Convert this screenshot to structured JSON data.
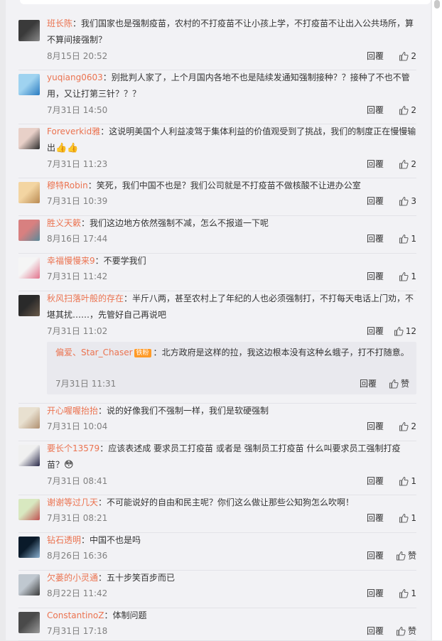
{
  "comments": [
    {
      "user": "班长陈",
      "text": "我们国家也是强制疫苗，农村的不打疫苗不让小孩上学，不打疫苗不让出入公共场所，算不算间接强制？",
      "time": "8月15日 20:52",
      "reply": "回覆",
      "likes": "2",
      "avatar_colors": [
        "#3a3a3a",
        "#8a8a8a"
      ]
    },
    {
      "user": "yuqiang0603",
      "text": "别批判人家了，上个月国内各地不也是陆续发通知强制接种？？接种了不也不管用，又让打第三针？？？",
      "time": "7月31日 14:50",
      "reply": "回覆",
      "likes": "2",
      "avatar_colors": [
        "#9fd3f0",
        "#2a7bc0"
      ]
    },
    {
      "user": "Foreverkid雅",
      "text": "这说明美国个人利益凌驾于集体利益的价值观受到了挑战，我们的制度正在慢慢输出",
      "time": "7月31日 11:23",
      "reply": "回覆",
      "likes": "2",
      "avatar_colors": [
        "#e8d0c8",
        "#2b2b2b"
      ]
    },
    {
      "user": "穆特Robin",
      "text": "笑死，我们中国不也是？我们公司就是不打疫苗不做核酸不让进办公室",
      "time": "7月31日 10:39",
      "reply": "回覆",
      "likes": "3",
      "avatar_colors": [
        "#f3d5a2",
        "#b98a52"
      ]
    },
    {
      "user": "胜义天簌",
      "text": "我们这边地方依然强制不减，怎么不报道一下呢",
      "time": "8月16日 17:44",
      "reply": "回覆",
      "likes": "1",
      "avatar_colors": [
        "#d88080",
        "#5a8a9a"
      ]
    },
    {
      "user": "幸福慢慢来9",
      "text": "不要学我们",
      "time": "7月31日 11:42",
      "reply": "回覆",
      "likes": "1",
      "avatar_colors": [
        "#f5f5f5",
        "#e2738c"
      ]
    },
    {
      "user": "秋风扫落叶般的存在",
      "text": "半斤八两，甚至农村上了年纪的人也必须强制打，不打每天电话上门劝，不堪其扰……，先管好自己再说吧",
      "time": "7月31日 11:02",
      "reply": "回覆",
      "likes": "12",
      "avatar_colors": [
        "#2a2a2a",
        "#6a5a4a"
      ]
    },
    {
      "user": "开心喔喔抬抬",
      "text": "说的好像我们不强制一样，我们是软硬强制",
      "time": "7月31日 10:04",
      "reply": "回覆",
      "likes": "2",
      "avatar_colors": [
        "#e8e0d0",
        "#b09070"
      ]
    },
    {
      "user": "要长个13579",
      "text": "应该表述成 要求员工打疫苗 或者是 强制员工打疫苗 什么叫要求员工强制打疫苗？",
      "time": "7月31日 08:41",
      "reply": "回覆",
      "likes": "1",
      "avatar_colors": [
        "#f0f0f0",
        "#2a2a4a"
      ]
    },
    {
      "user": "谢谢等过几天",
      "text": "不可能说好的自由和民主呢？你们这么做让那些公知狗怎么吹啊！",
      "time": "7月31日 08:21",
      "reply": "回覆",
      "likes": "1",
      "avatar_colors": [
        "#d8e8c0",
        "#c05050"
      ]
    },
    {
      "user": "钻石透明",
      "text": "中国不也是吗",
      "time": "8月26日 16:36",
      "reply": "回覆",
      "likes": "赞",
      "avatar_colors": [
        "#0a1a2a",
        "#8ab0d0"
      ]
    },
    {
      "user": "欠蒌的小灵通",
      "text": "五十步笑百步而已",
      "time": "8月22日 11:42",
      "reply": "回覆",
      "likes": "1",
      "avatar_colors": [
        "#c0c8d0",
        "#3a3a3a"
      ]
    },
    {
      "user": "ConstantinoZ",
      "text": "体制问题",
      "time": "7月31日 17:18",
      "reply": "回覆",
      "likes": "赞",
      "avatar_colors": [
        "#4a4a4a",
        "#9a9a9a"
      ]
    }
  ],
  "sub_reply": {
    "user": "偏爱、Star_Chaser",
    "badge": "铁粉",
    "text": "北方政府是这样的拉，我这边根本没有这种幺蛾子，打不打随意。",
    "time": "7月31日 11:31",
    "reply": "回覆",
    "likes": "赞"
  },
  "emojis": {
    "thumbs_up_pair": "👍👍",
    "flushed": "😳"
  }
}
